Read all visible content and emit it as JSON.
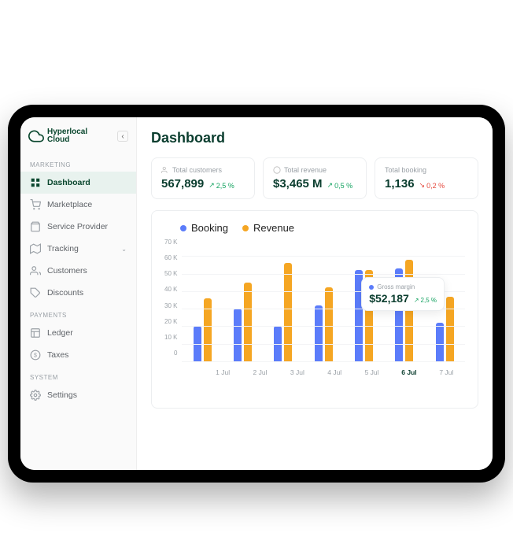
{
  "brand": {
    "line1": "Hyperlocal",
    "line2": "Cloud"
  },
  "sidebar": {
    "sections": {
      "marketing": "MARKETING",
      "payments": "PAYMENTS",
      "system": "SYSTEM"
    },
    "items": {
      "dashboard": "Dashboard",
      "marketplace": "Marketplace",
      "service_provider": "Service Provider",
      "tracking": "Tracking",
      "customers": "Customers",
      "discounts": "Discounts",
      "ledger": "Ledger",
      "taxes": "Taxes",
      "settings": "Settings"
    }
  },
  "page_title": "Dashboard",
  "stats": {
    "customers": {
      "label": "Total customers",
      "value": "567,899",
      "trend": "2,5 %",
      "dir": "up"
    },
    "revenue": {
      "label": "Total revenue",
      "value": "$3,465 M",
      "trend": "0,5 %",
      "dir": "up"
    },
    "booking": {
      "label": "Total booking",
      "value": "1,136",
      "trend": "0,2 %",
      "dir": "down"
    }
  },
  "legend": {
    "booking": "Booking",
    "revenue": "Revenue"
  },
  "tooltip": {
    "label": "Gross margin",
    "value": "$52,187",
    "trend": "2,5 %"
  },
  "chart_data": {
    "type": "bar",
    "title": "",
    "xlabel": "",
    "ylabel": "",
    "ylim": [
      0,
      70
    ],
    "y_ticks": [
      "70 K",
      "60 K",
      "50 K",
      "40 K",
      "30 K",
      "20 K",
      "10 K",
      "0"
    ],
    "categories": [
      "1 Jul",
      "2 Jul",
      "3 Jul",
      "4 Jul",
      "5 Jul",
      "6 Jul",
      "7 Jul"
    ],
    "active_category": "6 Jul",
    "series": [
      {
        "name": "Booking",
        "color": "#5b7cfa",
        "values": [
          20,
          30,
          20,
          32,
          52,
          53,
          22
        ]
      },
      {
        "name": "Revenue",
        "color": "#f5a623",
        "values": [
          36,
          45,
          56,
          42,
          52,
          58,
          37
        ]
      }
    ],
    "legend_position": "top-left",
    "grid": true
  }
}
